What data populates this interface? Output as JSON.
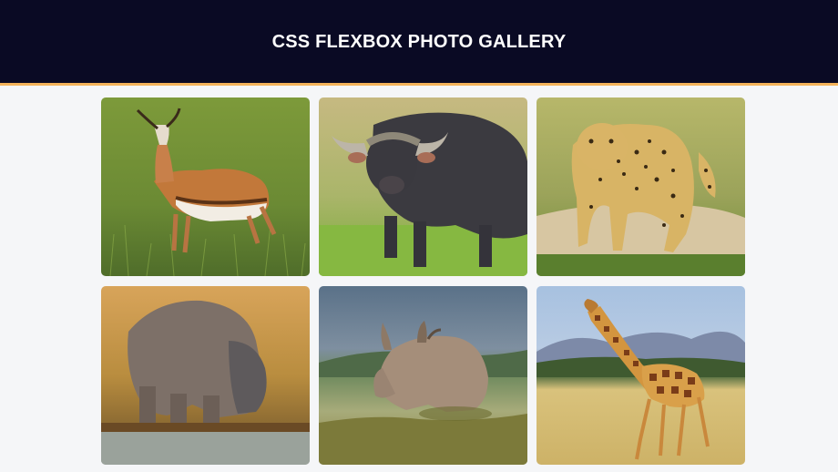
{
  "header": {
    "title": "CSS FLEXBOX PHOTO GALLERY"
  },
  "gallery": {
    "photos": [
      {
        "subject": "springbok antelope"
      },
      {
        "subject": "cape buffalo"
      },
      {
        "subject": "leopard"
      },
      {
        "subject": "hippopotamus"
      },
      {
        "subject": "white rhinoceros"
      },
      {
        "subject": "giraffe"
      }
    ]
  },
  "colors": {
    "header_bg": "#0a0a24",
    "header_border": "#f4b35b",
    "page_bg": "#f5f6f8"
  }
}
